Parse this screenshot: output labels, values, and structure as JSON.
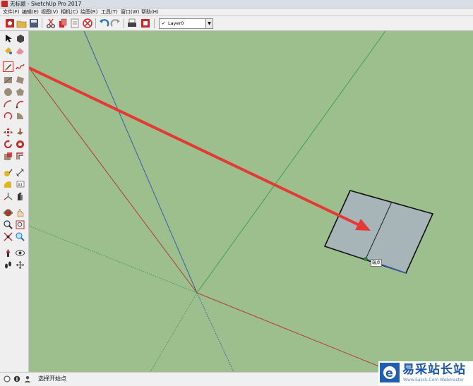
{
  "window": {
    "title": "无标题 - SketchUp Pro 2017"
  },
  "menu": [
    "文件(F)",
    "编辑(E)",
    "视图(V)",
    "相机(C)",
    "绘图(R)",
    "工具(T)",
    "窗口(W)",
    "帮助(H)"
  ],
  "layer": {
    "check": "✓",
    "name": "Layer0"
  },
  "viewport": {
    "tooltip": "端点"
  },
  "status": {
    "text": "选择开始点"
  },
  "watermark": {
    "brand": "易采站长站",
    "site": "Www.Easck.Com Webmaster"
  },
  "colors": {
    "background": "#9dbf8d",
    "red_axis": "#b53b34",
    "green_axis": "#3fa34a",
    "blue_axis": "#3a5ca8",
    "face": "#a7b5b8",
    "arrow": "#e53935"
  }
}
